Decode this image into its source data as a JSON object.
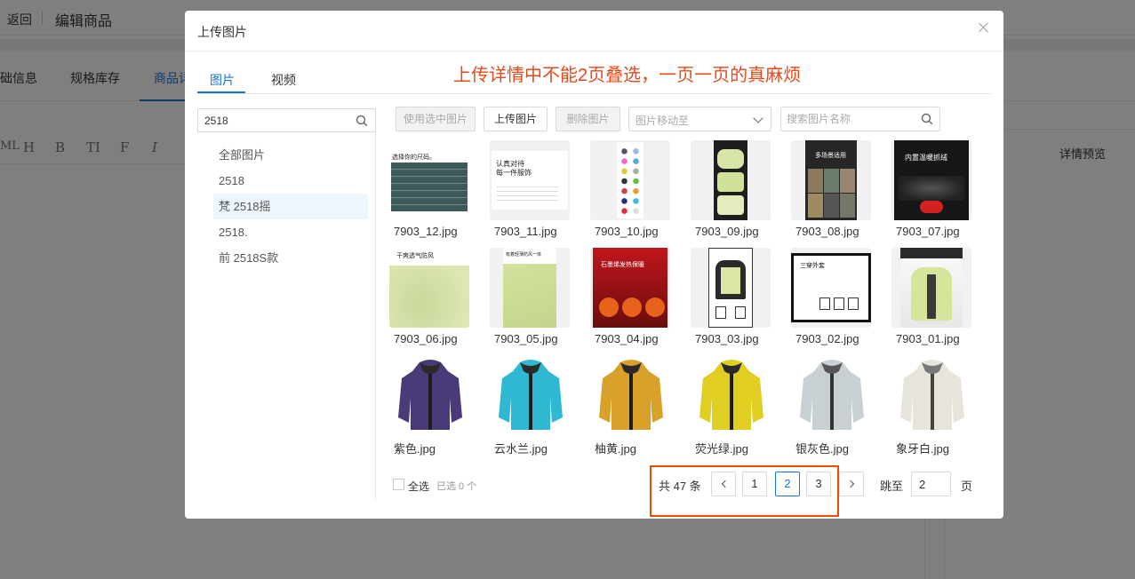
{
  "background": {
    "back_label": "返回",
    "page_title": "编辑商品",
    "tabs": [
      "础信息",
      "规格库存",
      "商品详"
    ],
    "toolbar": [
      "ML",
      "H",
      "B",
      "TI",
      "F",
      "I"
    ],
    "preview_label": "详情预览"
  },
  "modal": {
    "title": "上传图片",
    "tabs": [
      {
        "label": "图片",
        "active": true
      },
      {
        "label": "视频",
        "active": false
      }
    ],
    "annotation": "上传详情中不能2页叠选，一页一页的真麻烦",
    "annotation_color": "#e64a19",
    "left": {
      "search_value": "2518",
      "categories": [
        {
          "label": "全部图片",
          "active": false
        },
        {
          "label": "2518",
          "active": false
        },
        {
          "label": "梵 2518摇",
          "active": true
        },
        {
          "label": "2518.",
          "active": false
        },
        {
          "label": "前 2518S款",
          "active": false
        }
      ]
    },
    "toolbar": {
      "use_selected": "使用选中图片",
      "upload": "上传图片",
      "delete": "删除图片",
      "move_placeholder": "图片移动至",
      "search_placeholder": "搜索图片名称"
    },
    "images": [
      {
        "name": "7903_12.jpg",
        "kind": "size-table"
      },
      {
        "name": "7903_11.jpg",
        "kind": "text-card"
      },
      {
        "name": "7903_10.jpg",
        "kind": "color-grid"
      },
      {
        "name": "7903_09.jpg",
        "kind": "detail-dark"
      },
      {
        "name": "7903_08.jpg",
        "kind": "scene-poster"
      },
      {
        "name": "7903_07.jpg",
        "kind": "dark-poster"
      },
      {
        "name": "7903_06.jpg",
        "kind": "fabric-closeup"
      },
      {
        "name": "7903_05.jpg",
        "kind": "fabric-closeup"
      },
      {
        "name": "7903_04.jpg",
        "kind": "red-poster"
      },
      {
        "name": "7903_03.jpg",
        "kind": "jacket-diagram"
      },
      {
        "name": "7903_02.jpg",
        "kind": "info-card"
      },
      {
        "name": "7903_01.jpg",
        "kind": "model-photo"
      },
      {
        "name": "紫色.jpg",
        "kind": "jacket",
        "color": "#4b3a78"
      },
      {
        "name": "云水兰.jpg",
        "kind": "jacket",
        "color": "#2fb8d2"
      },
      {
        "name": "柚黄.jpg",
        "kind": "jacket",
        "color": "#d9a02a"
      },
      {
        "name": "荧光绿.jpg",
        "kind": "jacket",
        "color": "#e0cf22"
      },
      {
        "name": "银灰色.jpg",
        "kind": "jacket",
        "color": "#c9d0d4"
      },
      {
        "name": "象牙白.jpg",
        "kind": "jacket",
        "color": "#e7e4dc"
      }
    ],
    "thumb_text": {
      "size_table": "选择你的尺码。",
      "text_card_line1": "认真对待",
      "text_card_line2": "每一件服饰",
      "scene_title": "多场景适用",
      "dark_title": "内置温暖抓绒",
      "fabric_title1": "干爽透气防风",
      "fabric_title2": "有着轻薄防风一体",
      "red_title": "石墨烯发热保暖",
      "info_title": "三穿外套"
    },
    "footer": {
      "select_all": "全选",
      "selected": "已选 0 个",
      "total": "共 47 条",
      "pages": [
        "1",
        "2",
        "3"
      ],
      "current_page": "2",
      "jump_label": "跳至",
      "jump_value": "2",
      "jump_unit": "页"
    }
  }
}
